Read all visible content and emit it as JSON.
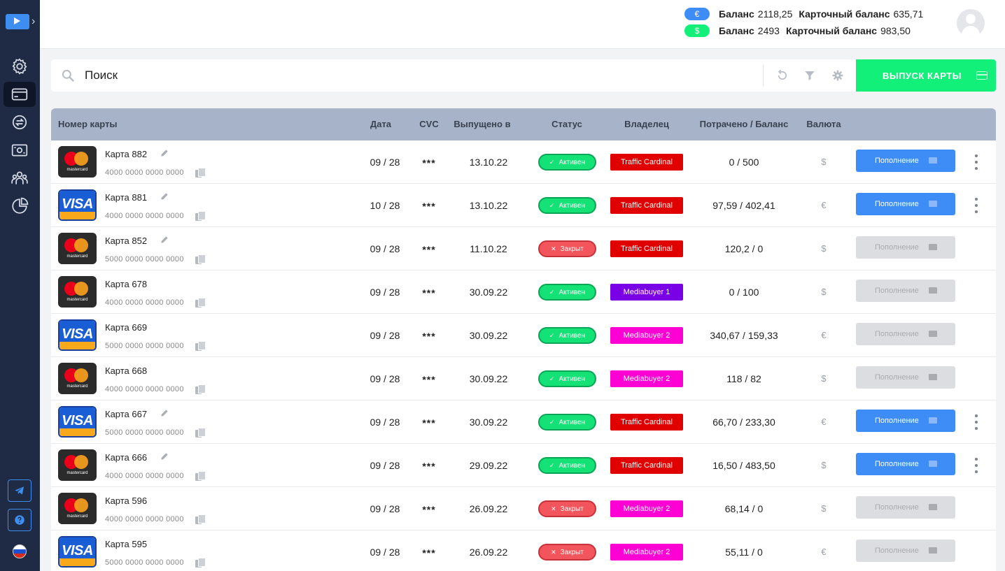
{
  "header": {
    "balances": [
      {
        "currency_icon": "€",
        "color": "#3e8cf6",
        "label": "Баланс",
        "value": "2118,25",
        "card_label": "Карточный баланс",
        "card_value": "635,71"
      },
      {
        "currency_icon": "$",
        "color": "#12f07a",
        "label": "Баланс",
        "value": "2493",
        "card_label": "Карточный баланс",
        "card_value": "983,50"
      }
    ]
  },
  "sidebar": {
    "items": [
      "settings-icon",
      "card-icon",
      "exchange-icon",
      "money-icon",
      "users-icon",
      "pie-chart-icon"
    ],
    "active_index": 1,
    "bottom": [
      "telegram-icon",
      "help-icon",
      "language-flag-ru"
    ]
  },
  "toolbar": {
    "search_placeholder": "Поиск",
    "issue_label": "ВЫПУСК КАРТЫ"
  },
  "table": {
    "headers": {
      "card": "Номер карты",
      "date": "Дата",
      "cvc": "CVC",
      "issued": "Выпущено в",
      "status": "Статус",
      "owner": "Владелец",
      "spent": "Потрачено / Баланс",
      "currency": "Валюта"
    },
    "topup_label": "Пополнение",
    "status_labels": {
      "active": "Активен",
      "closed": "Закрыт"
    },
    "owner_colors": {
      "Traffic Cardinal": "#e00000",
      "Mediabuyer 1": "#7a00e6",
      "Mediabuyer 2": "#ff00d4"
    },
    "rows": [
      {
        "brand": "mastercard",
        "name": "Карта 882",
        "editable": true,
        "number": "4000 0000 0000 0000",
        "date": "09 / 28",
        "cvc": "***",
        "issued": "13.10.22",
        "status": "active",
        "owner": "Traffic Cardinal",
        "spent": "0 / 500",
        "currency": "$",
        "topup_enabled": true
      },
      {
        "brand": "visa",
        "name": "Карта 881",
        "editable": true,
        "number": "4000 0000 0000 0000",
        "date": "10 / 28",
        "cvc": "***",
        "issued": "13.10.22",
        "status": "active",
        "owner": "Traffic Cardinal",
        "spent": "97,59 / 402,41",
        "currency": "€",
        "topup_enabled": true
      },
      {
        "brand": "mastercard",
        "name": "Карта 852",
        "editable": true,
        "number": "5000 0000 0000 0000",
        "date": "09 / 28",
        "cvc": "***",
        "issued": "11.10.22",
        "status": "closed",
        "owner": "Traffic Cardinal",
        "spent": "120,2 / 0",
        "currency": "$",
        "topup_enabled": false
      },
      {
        "brand": "mastercard",
        "name": "Карта 678",
        "editable": false,
        "number": "4000 0000 0000 0000",
        "date": "09 / 28",
        "cvc": "***",
        "issued": "30.09.22",
        "status": "active",
        "owner": "Mediabuyer 1",
        "spent": "0 / 100",
        "currency": "$",
        "topup_enabled": false
      },
      {
        "brand": "visa",
        "name": "Карта 669",
        "editable": false,
        "number": "5000 0000 0000 0000",
        "date": "09 / 28",
        "cvc": "***",
        "issued": "30.09.22",
        "status": "active",
        "owner": "Mediabuyer 2",
        "spent": "340,67 / 159,33",
        "currency": "€",
        "topup_enabled": false
      },
      {
        "brand": "mastercard",
        "name": "Карта 668",
        "editable": false,
        "number": "4000 0000 0000 0000",
        "date": "09 / 28",
        "cvc": "***",
        "issued": "30.09.22",
        "status": "active",
        "owner": "Mediabuyer 2",
        "spent": "118 / 82",
        "currency": "$",
        "topup_enabled": false
      },
      {
        "brand": "visa",
        "name": "Карта 667",
        "editable": true,
        "number": "5000 0000 0000 0000",
        "date": "09 / 28",
        "cvc": "***",
        "issued": "30.09.22",
        "status": "active",
        "owner": "Traffic Cardinal",
        "spent": "66,70 / 233,30",
        "currency": "€",
        "topup_enabled": true
      },
      {
        "brand": "mastercard",
        "name": "Карта 666",
        "editable": true,
        "number": "4000 0000 0000 0000",
        "date": "09 / 28",
        "cvc": "***",
        "issued": "29.09.22",
        "status": "active",
        "owner": "Traffic Cardinal",
        "spent": "16,50 / 483,50",
        "currency": "$",
        "topup_enabled": true
      },
      {
        "brand": "mastercard",
        "name": "Карта 596",
        "editable": false,
        "number": "4000 0000 0000 0000",
        "date": "09 / 28",
        "cvc": "***",
        "issued": "26.09.22",
        "status": "closed",
        "owner": "Mediabuyer 2",
        "spent": "68,14 / 0",
        "currency": "$",
        "topup_enabled": false
      },
      {
        "brand": "visa",
        "name": "Карта 595",
        "editable": false,
        "number": "5000 0000 0000 0000",
        "date": "09 / 28",
        "cvc": "***",
        "issued": "26.09.22",
        "status": "closed",
        "owner": "Mediabuyer 2",
        "spent": "55,11 / 0",
        "currency": "€",
        "topup_enabled": false
      }
    ]
  }
}
